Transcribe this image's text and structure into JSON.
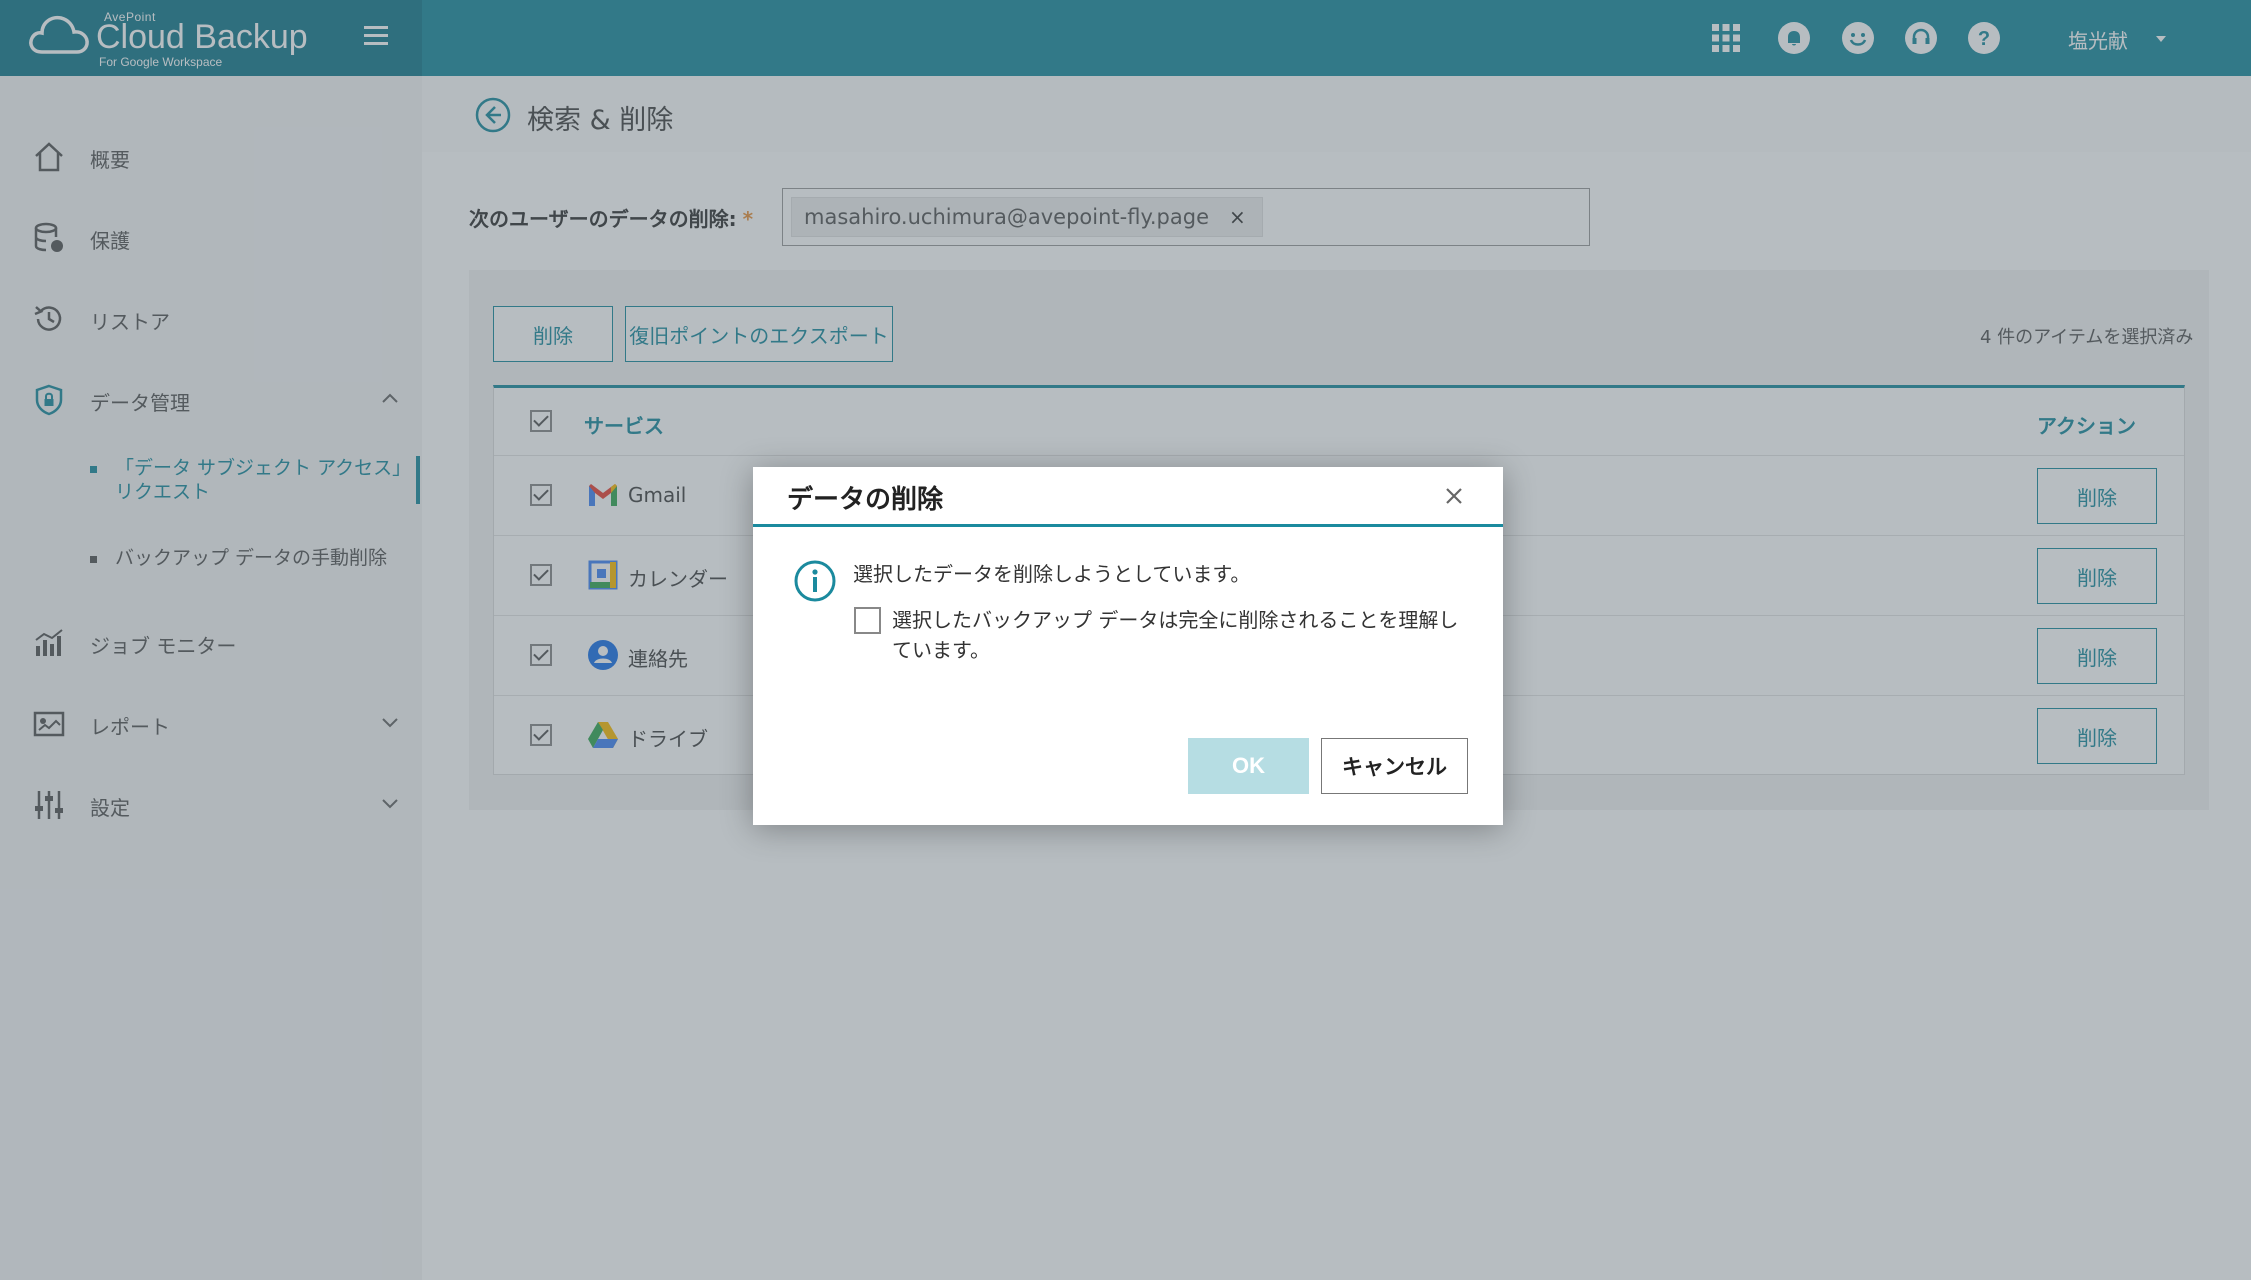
{
  "brand": {
    "vendor": "AvePoint",
    "title": "Cloud Backup",
    "subtitle": "For Google Workspace"
  },
  "topbar": {
    "icons": [
      "apps-grid-icon",
      "bell-icon",
      "smiley-feedback-icon",
      "headset-support-icon",
      "help-icon"
    ],
    "user_name": "塩光献"
  },
  "sidebar": {
    "items": [
      {
        "label": "概要",
        "icon": "home-icon"
      },
      {
        "label": "保護",
        "icon": "database-shield-icon"
      },
      {
        "label": "リストア",
        "icon": "history-icon"
      },
      {
        "label": "データ管理",
        "icon": "shield-lock-icon",
        "expanded": true
      },
      {
        "label": "ジョブ モニター",
        "icon": "bar-chart-icon"
      },
      {
        "label": "レポート",
        "icon": "report-icon"
      },
      {
        "label": "設定",
        "icon": "sliders-icon"
      }
    ],
    "sub_items": [
      {
        "label": "「データ サブジェクト アクセス」リクエスト",
        "active": true
      },
      {
        "label": "バックアップ データの手動削除",
        "active": false
      }
    ]
  },
  "page": {
    "title": "検索 & 削除",
    "form_label": "次のユーザーのデータの削除:",
    "required_mark": "*",
    "user_chip": "masahiro.uchimura@avepoint-fly.page",
    "chip_remove": "×"
  },
  "toolbar": {
    "delete_label": "削除",
    "export_label": "復旧ポイントのエクスポート",
    "selected_count": "4 件のアイテムを選択済み"
  },
  "table": {
    "columns": [
      "サービス",
      "アクション"
    ],
    "rows": [
      {
        "service": "Gmail",
        "icon": "gmail-icon",
        "action": "削除",
        "checked": true
      },
      {
        "service": "カレンダー",
        "icon": "calendar-icon",
        "action": "削除",
        "checked": true
      },
      {
        "service": "連絡先",
        "icon": "contacts-icon",
        "action": "削除",
        "checked": true
      },
      {
        "service": "ドライブ",
        "icon": "drive-icon",
        "action": "削除",
        "checked": true
      }
    ]
  },
  "modal": {
    "title": "データの削除",
    "message": "選択したデータを削除しようとしています。",
    "confirm_label": "選択したバックアップ データは完全に削除されることを理解しています。",
    "confirm_checked": false,
    "ok_label": "OK",
    "cancel_label": "キャンセル"
  },
  "colors": {
    "accent": "#1b8a9e",
    "ok_disabled": "#b6dde3",
    "required": "#e8923c"
  }
}
